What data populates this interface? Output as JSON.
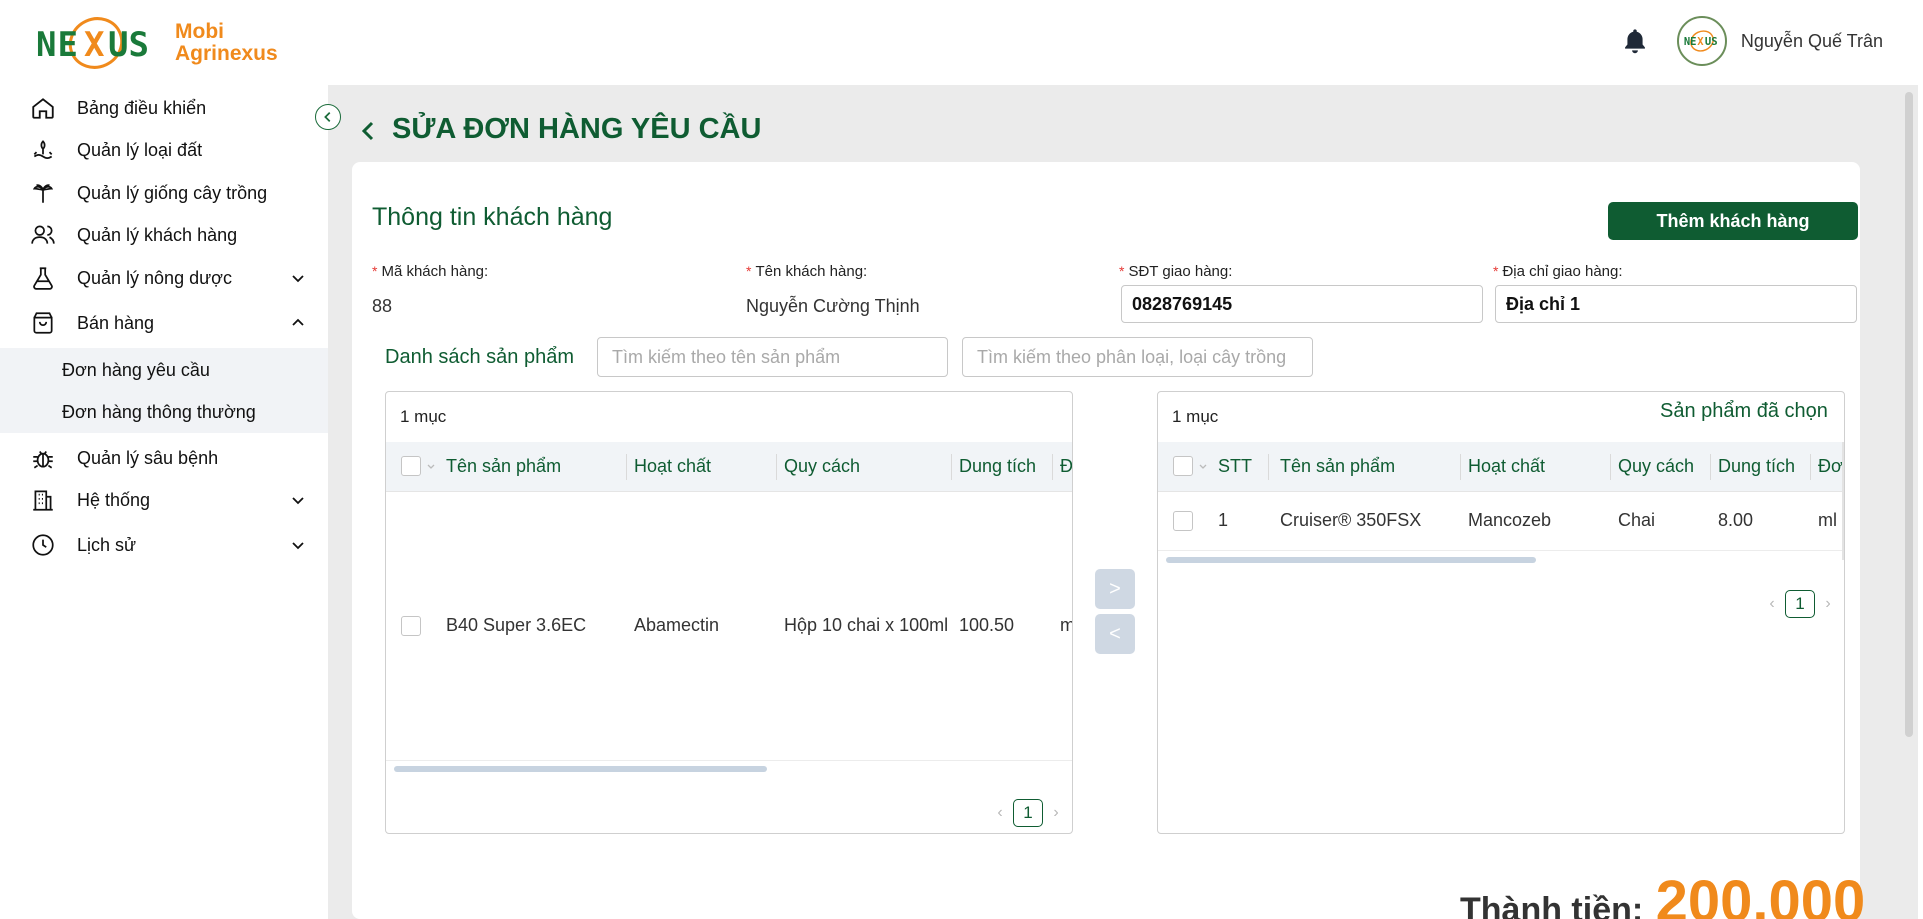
{
  "app": {
    "brand_line1": "Mobi",
    "brand_line2": "Agrinexus",
    "logo_text": "NEXUS",
    "accent_color": "#0f5c32",
    "brand_color": "#f08a1c"
  },
  "header": {
    "user_name": "Nguyễn Quế Trân",
    "avatar_text": "NEXUS"
  },
  "sidebar": {
    "items": [
      {
        "label": "Bảng điều khiển",
        "icon": "home-icon"
      },
      {
        "label": "Quản lý loại đất",
        "icon": "soil-icon"
      },
      {
        "label": "Quản lý giống cây trồng",
        "icon": "plant-icon"
      },
      {
        "label": "Quản lý khách hàng",
        "icon": "users-icon"
      },
      {
        "label": "Quản lý nông dược",
        "icon": "flask-icon"
      },
      {
        "label": "Bán hàng",
        "icon": "bag-icon"
      },
      {
        "label": "Quản lý sâu bệnh",
        "icon": "bug-icon"
      },
      {
        "label": "Hệ thống",
        "icon": "building-icon"
      },
      {
        "label": "Lịch sử",
        "icon": "clock-icon"
      }
    ],
    "sub_items": [
      "Đơn hàng yêu cầu",
      "Đơn hàng thông thường"
    ]
  },
  "page": {
    "title": "SỬA ĐƠN HÀNG YÊU CẦU"
  },
  "customer": {
    "section_title": "Thông tin khách hàng",
    "add_button": "Thêm khách hàng",
    "code_label": "Mã khách hàng:",
    "code_value": "88",
    "name_label": "Tên khách hàng:",
    "name_value": "Nguyễn Cường Thịnh",
    "phone_label": "SĐT giao hàng:",
    "phone_value": "0828769145",
    "address_label": "Địa chỉ giao hàng:",
    "address_value": "Địa chỉ 1"
  },
  "products": {
    "section_title": "Danh sách sản phẩm",
    "search_name_placeholder": "Tìm kiếm theo tên sản phẩm",
    "search_type_placeholder": "Tìm kiếm theo phân loại, loại cây trồng"
  },
  "left_table": {
    "count": "1 mục",
    "columns": [
      "Tên sản phẩm",
      "Hoạt chất",
      "Quy cách",
      "Dung tích",
      "Đ"
    ],
    "rows": [
      {
        "name": "B40 Super 3.6EC",
        "ingredient": "Abamectin",
        "spec": "Hộp 10 chai x 100ml",
        "volume": "100.50",
        "unit": "m"
      }
    ],
    "page": "1"
  },
  "right_table": {
    "title": "Sản phẩm đã chọn",
    "count": "1 mục",
    "columns": [
      "STT",
      "Tên sản phẩm",
      "Hoạt chất",
      "Quy cách",
      "Dung tích",
      "Đơ"
    ],
    "rows": [
      {
        "stt": "1",
        "name": "Cruiser® 350FSX",
        "ingredient": "Mancozeb",
        "spec": "Chai",
        "volume": "8.00",
        "unit": "ml"
      }
    ],
    "page": "1"
  },
  "transfer": {
    "right": ">",
    "left": "<"
  },
  "total": {
    "label": "Thành tiền:",
    "value": "200.000"
  }
}
